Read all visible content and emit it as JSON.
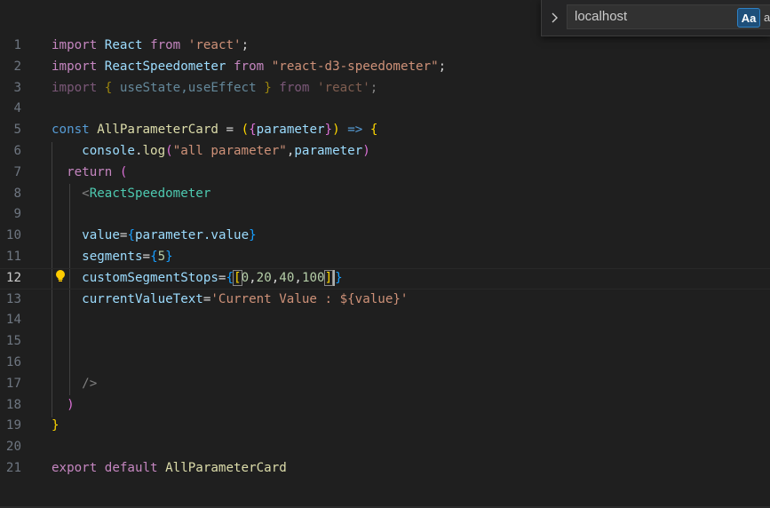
{
  "find_widget": {
    "search_value": "localhost",
    "match_case_label": "Aa",
    "whole_word_label": "ab",
    "toggle_icon": "chevron-right-icon"
  },
  "editor": {
    "active_line": 12,
    "line_numbers": [
      "1",
      "2",
      "3",
      "4",
      "5",
      "6",
      "7",
      "8",
      "9",
      "10",
      "11",
      "12",
      "13",
      "14",
      "15",
      "16",
      "17",
      "18",
      "19",
      "20",
      "21"
    ],
    "lightbulb_icon": "lightbulb-icon",
    "code": {
      "l1": {
        "kw1": "import",
        "id": "React",
        "kw2": "from",
        "str": "'react'",
        "end": ";"
      },
      "l2": {
        "kw1": "import",
        "id": "ReactSpeedometer",
        "kw2": "from",
        "str": "\"react-d3-speedometer\"",
        "end": ";"
      },
      "l3": {
        "kw1": "import",
        "open": "{",
        "ids": "useState,useEffect",
        "close": "}",
        "kw2": "from",
        "str": "'react'",
        "end": ";"
      },
      "l5": {
        "kw": "const",
        "name": "AllParameterCard",
        "eq": "=",
        "po": "(",
        "bo": "{",
        "param": "parameter",
        "bc": "}",
        "pc": ")",
        "arrow": "=>",
        "brace": "{"
      },
      "l6": {
        "obj": "console",
        "dot": ".",
        "fn": "log",
        "po": "(",
        "str": "\"all parameter\"",
        "comma": ",",
        "arg": "parameter",
        "pc": ")"
      },
      "l7": {
        "kw": "return",
        "paren": "("
      },
      "l8": {
        "lt": "<",
        "tag": "ReactSpeedometer"
      },
      "l10": {
        "attr": "value",
        "eq": "=",
        "bo": "{",
        "expr": "parameter.value",
        "bc": "}"
      },
      "l11": {
        "attr": "segments",
        "eq": "=",
        "bo": "{",
        "num": "5",
        "bc": "}"
      },
      "l12": {
        "attr": "customSegmentStops",
        "eq": "=",
        "bo": "{",
        "ao": "[",
        "n1": "0",
        "n2": "20",
        "n3": "40",
        "n4": "100",
        "comma": ",",
        "ac": "]",
        "bc": "}"
      },
      "l13": {
        "attr": "currentValueText",
        "eq": "=",
        "str": "'Current Value : ${value}'"
      },
      "l17": {
        "close": "/>"
      },
      "l18": {
        "paren": ")"
      },
      "l19": {
        "brace": "}"
      },
      "l21": {
        "kw1": "export",
        "kw2": "default",
        "id": "AllParameterCard"
      }
    }
  }
}
